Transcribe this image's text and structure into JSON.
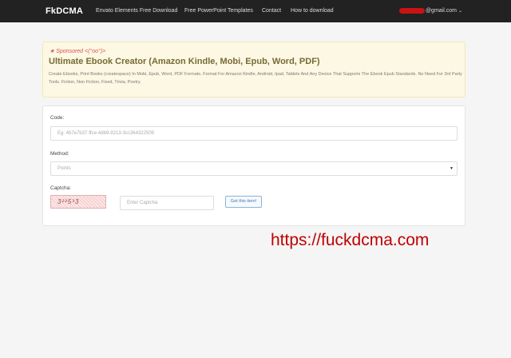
{
  "navbar": {
    "brand": "FkDCMA",
    "links": [
      "Envato Elements Free Download",
      "Free PowerPoint Templates",
      "Contact",
      "How to download"
    ],
    "user_email_suffix": "@gmail.com",
    "caret": "⌄"
  },
  "sponsor": {
    "tag": "★ Sponsored <(°oo°)>",
    "title": "Ultimate Ebook Creator (Amazon Kindle, Mobi, Epub, Word, PDF)",
    "description": "Create Ebooks, Print Books (createspace) In Mobi, Epub, Word, PDF Formats. Format For Amazon Kindle, Android, Ipad, Tablets And Any Device That Supports The Ebook Epub Standards. No Need For 3rd Party Tools. Fiction, Non Fiction, Fixed, Trivia, Poetry."
  },
  "form": {
    "code_label": "Code:",
    "code_placeholder": "Eg: 4b7e7b37-ffce-4db9-9213-3cc364322509",
    "method_label": "Method:",
    "method_selected": "Points",
    "select_arrow": "▼",
    "captcha_label": "Captcha:",
    "captcha_text": "3²²5³3",
    "captcha_placeholder": "Enter Captcha",
    "submit_label": "Get this item!"
  },
  "watermark": "https://fuckdcma.com",
  "colors": {
    "navbar": "#222222",
    "sponsor_bg": "#fcf8e3",
    "watermark": "#c00000"
  }
}
